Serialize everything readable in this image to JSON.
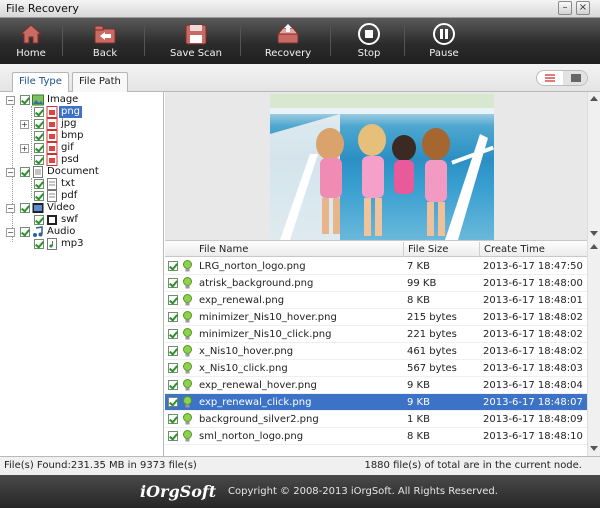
{
  "window": {
    "title": "File Recovery",
    "minimize": "–",
    "close": "×"
  },
  "toolbar": {
    "home": "Home",
    "back": "Back",
    "save_scan": "Save Scan",
    "recovery": "Recovery",
    "stop": "Stop",
    "pause": "Pause"
  },
  "tabs": {
    "file_type": "File Type",
    "file_path": "File Path"
  },
  "tree": {
    "image": "Image",
    "png": "png",
    "jpg": "jpg",
    "bmp": "bmp",
    "gif": "gif",
    "psd": "psd",
    "document": "Document",
    "txt": "txt",
    "pdf": "pdf",
    "video": "Video",
    "swf": "swf",
    "audio": "Audio",
    "mp3": "mp3"
  },
  "table": {
    "headers": {
      "name": "File Name",
      "size": "File Size",
      "time": "Create Time"
    },
    "rows": [
      {
        "name": "LRG_norton_logo.png",
        "size": "7 KB",
        "time": "2013-6-17  18:47:50"
      },
      {
        "name": "atrisk_background.png",
        "size": "99 KB",
        "time": "2013-6-17  18:48:00"
      },
      {
        "name": "exp_renewal.png",
        "size": "8 KB",
        "time": "2013-6-17  18:48:01"
      },
      {
        "name": "minimizer_Nis10_hover.png",
        "size": "215 bytes",
        "time": "2013-6-17  18:48:02"
      },
      {
        "name": "minimizer_Nis10_click.png",
        "size": "221 bytes",
        "time": "2013-6-17  18:48:02"
      },
      {
        "name": "x_Nis10_hover.png",
        "size": "461 bytes",
        "time": "2013-6-17  18:48:02"
      },
      {
        "name": "x_Nis10_click.png",
        "size": "567 bytes",
        "time": "2013-6-17  18:48:03"
      },
      {
        "name": "exp_renewal_hover.png",
        "size": "9 KB",
        "time": "2013-6-17  18:48:04"
      },
      {
        "name": "exp_renewal_click.png",
        "size": "9 KB",
        "time": "2013-6-17  18:48:07"
      },
      {
        "name": "background_silver2.png",
        "size": "1 KB",
        "time": "2013-6-17  18:48:09"
      },
      {
        "name": "sml_norton_logo.png",
        "size": "8 KB",
        "time": "2013-6-17  18:48:10"
      }
    ]
  },
  "status": {
    "found": "File(s) Found:231.35 MB in 9373 file(s)",
    "node": "1880 file(s) of total are in the current node."
  },
  "footer": {
    "brand": "iOrgSoft",
    "copyright": "Copyright © 2008-2013 iOrgSoft. All Rights Reserved."
  },
  "colors": {
    "selection": "#3c73c7",
    "toolbar": "#2c2c2c",
    "check": "#2d8f2d"
  }
}
